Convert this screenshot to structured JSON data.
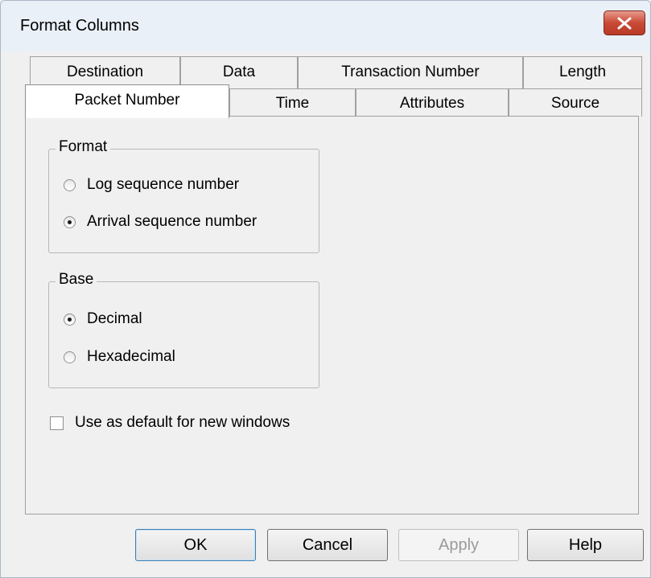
{
  "window": {
    "title": "Format Columns"
  },
  "tabs_back": [
    "Destination",
    "Data",
    "Transaction Number",
    "Length"
  ],
  "tabs_front": [
    "Packet Number",
    "Time",
    "Attributes",
    "Source"
  ],
  "active_tab": "Packet Number",
  "format_group": {
    "label": "Format",
    "options": [
      "Log sequence number",
      "Arrival sequence number"
    ],
    "selected": "Arrival sequence number"
  },
  "base_group": {
    "label": "Base",
    "options": [
      "Decimal",
      "Hexadecimal"
    ],
    "selected": "Decimal"
  },
  "default_checkbox": {
    "label": "Use as default for new windows",
    "checked": false
  },
  "buttons": {
    "ok": "OK",
    "cancel": "Cancel",
    "apply": "Apply",
    "help": "Help"
  }
}
